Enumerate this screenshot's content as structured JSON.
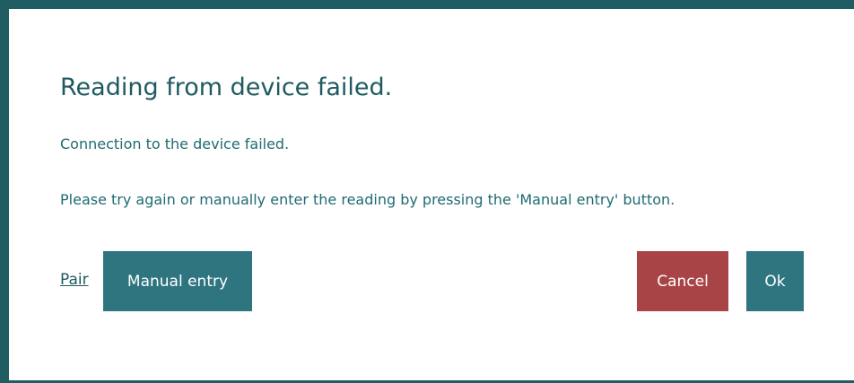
{
  "dialog": {
    "title": "Reading from device failed.",
    "message_line1": "Connection to the device failed.",
    "message_line2": "Please try again or manually enter the reading by pressing the 'Manual entry' button.",
    "pair_link": "Pair",
    "manual_entry_label": "Manual entry",
    "cancel_label": "Cancel",
    "ok_label": "Ok"
  },
  "colors": {
    "frame": "#1f5d63",
    "primary_button": "#2f7580",
    "cancel_button": "#a94446",
    "text": "#1e5a60"
  }
}
